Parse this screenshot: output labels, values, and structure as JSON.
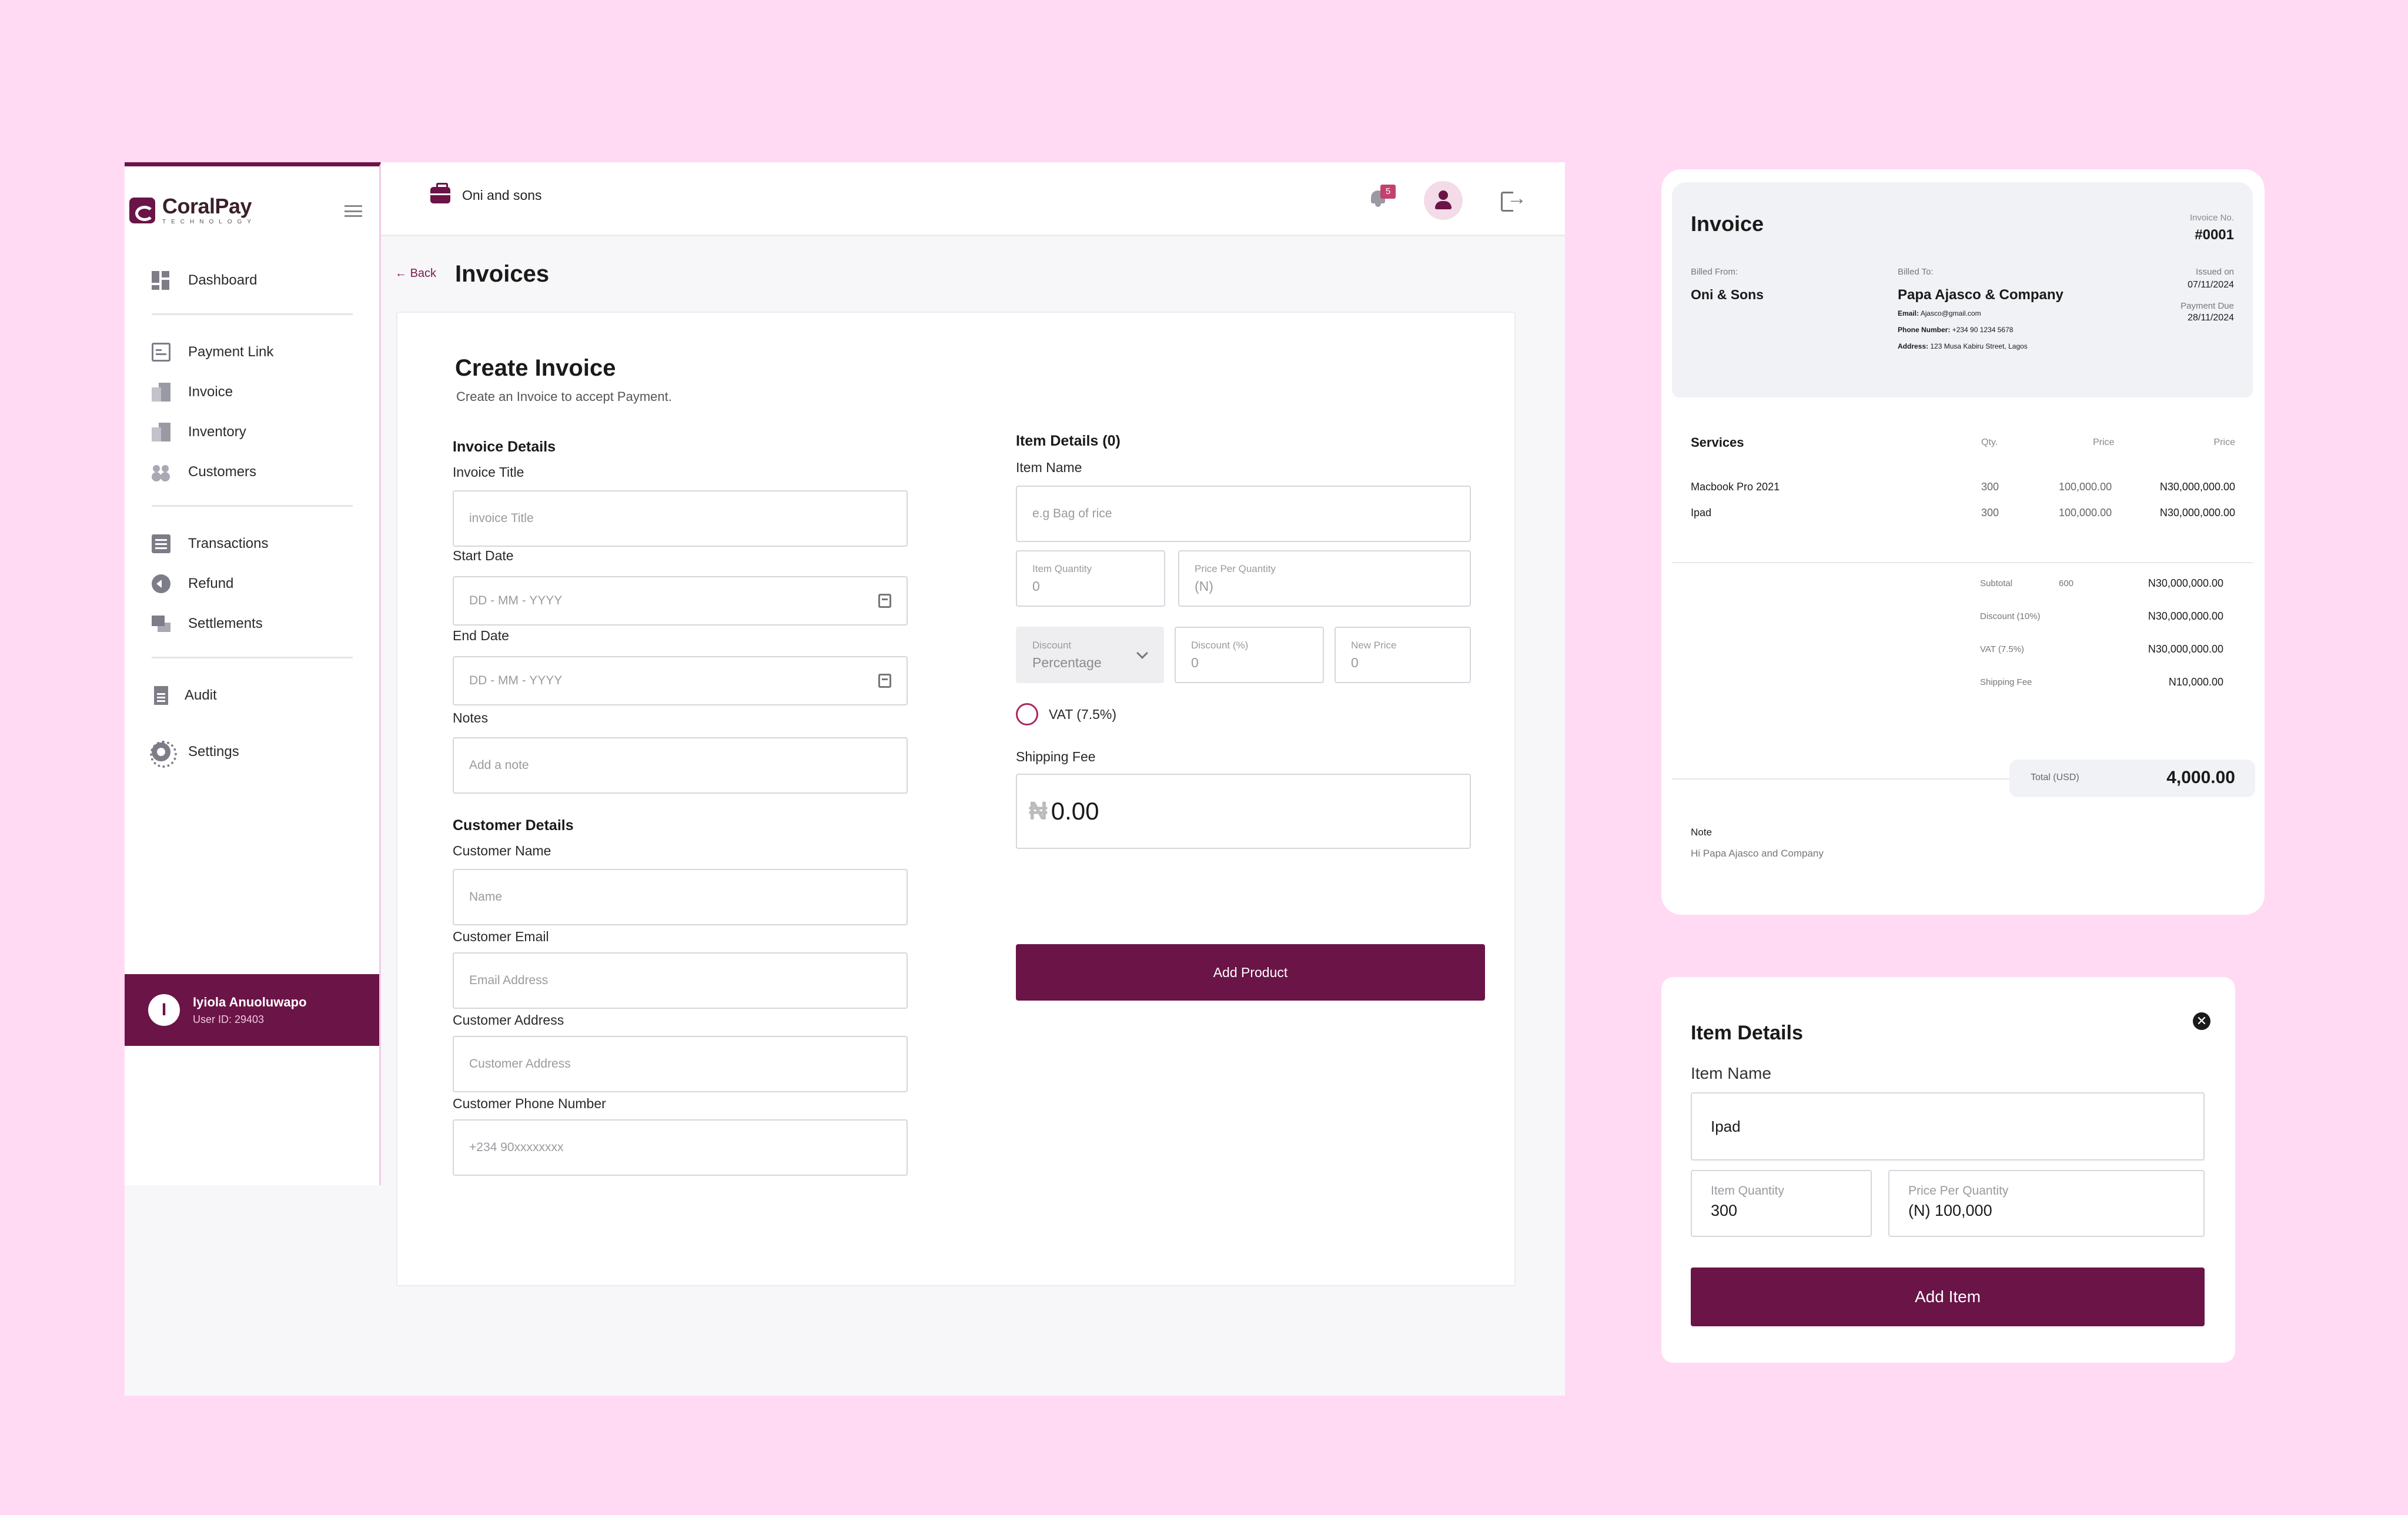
{
  "app": {
    "logo": {
      "name": "CoralPay",
      "sub": "TECHNOLOGY"
    },
    "sidebar": {
      "items": [
        {
          "label": "Dashboard",
          "icon": "dashboard-icon"
        },
        {
          "label": "Payment Link",
          "icon": "payment-link-icon"
        },
        {
          "label": "Invoice",
          "icon": "invoice-icon"
        },
        {
          "label": "Inventory",
          "icon": "inventory-icon"
        },
        {
          "label": "Customers",
          "icon": "customers-icon"
        },
        {
          "label": "Transactions",
          "icon": "transactions-icon"
        },
        {
          "label": "Refund",
          "icon": "refund-icon"
        },
        {
          "label": "Settlements",
          "icon": "settlements-icon"
        },
        {
          "label": "Audit",
          "icon": "audit-icon"
        },
        {
          "label": "Settings",
          "icon": "settings-icon"
        }
      ],
      "user": {
        "initial": "I",
        "name": "Iyiola Anuoluwapo",
        "id": "User ID: 29403"
      }
    },
    "topbar": {
      "org": "Oni and sons",
      "notifications": "5"
    },
    "back_label": "Back",
    "page_title": "Invoices",
    "form": {
      "title": "Create Invoice",
      "subtitle": "Create an Invoice to accept Payment.",
      "invoice_details": {
        "heading": "Invoice Details",
        "title_label": "Invoice Title",
        "title_placeholder": "invoice Title",
        "start_label": "Start Date",
        "start_placeholder": "DD - MM - YYYY",
        "end_label": "End Date",
        "end_placeholder": "DD - MM - YYYY",
        "notes_label": "Notes",
        "notes_placeholder": "Add a note"
      },
      "customer_details": {
        "heading": "Customer Details",
        "name_label": "Customer Name",
        "name_placeholder": "Name",
        "email_label": "Customer Email",
        "email_placeholder": "Email Address",
        "address_label": "Customer Address",
        "address_placeholder": "Customer Address",
        "phone_label": "Customer Phone Number",
        "phone_placeholder": "+234 90xxxxxxxx"
      },
      "item_details": {
        "heading": "Item Details (0)",
        "name_label": "Item Name",
        "name_placeholder": "e.g Bag of rice",
        "qty_label": "Item Quantity",
        "qty_value": "0",
        "ppq_label": "Price Per Quantity",
        "ppq_value": "(N)",
        "discount_label": "Discount",
        "discount_value": "Percentage",
        "discount_pct_label": "Discount (%)",
        "discount_pct_value": "0",
        "new_price_label": "New Price",
        "new_price_value": "0",
        "vat_label": "VAT (7.5%)",
        "shipping_label": "Shipping Fee",
        "shipping_currency": "₦",
        "shipping_value": "0.00",
        "add_product": "Add Product"
      }
    }
  },
  "invoice": {
    "title": "Invoice",
    "number_label": "Invoice No.",
    "number": "#0001",
    "billed_from_label": "Billed From:",
    "billed_from": "Oni & Sons",
    "billed_to_label": "Billed To:",
    "billed_to": "Papa Ajasco & Company",
    "email_label": "Email:",
    "email": "Ajasco@gmail.com",
    "phone_label": "Phone Number:",
    "phone": "+234 90 1234 5678",
    "address_label": "Address:",
    "address": "123 Musa Kabiru Street, Lagos",
    "issued_label": "Issued on",
    "issued": "07/11/2024",
    "due_label": "Payment Due",
    "due": "28/11/2024",
    "table_headers": [
      "Services",
      "Qty.",
      "Price",
      "Price"
    ],
    "rows": [
      {
        "service": "Macbook Pro 2021",
        "qty": "300",
        "price": "100,000.00",
        "total": "N30,000,000.00"
      },
      {
        "service": "Ipad",
        "qty": "300",
        "price": "100,000.00",
        "total": "N30,000,000.00"
      }
    ],
    "subtotal_label": "Subtotal",
    "subtotal_qty": "600",
    "subtotal": "N30,000,000.00",
    "discount_label": "Discount (10%)",
    "discount": "N30,000,000.00",
    "vat_label": "VAT (7.5%)",
    "vat": "N30,000,000.00",
    "shipping_label": "Shipping Fee",
    "shipping": "N10,000.00",
    "total_label": "Total (USD)",
    "total": "4,000.00",
    "note_label": "Note",
    "note": "Hi Papa Ajasco and Company"
  },
  "item_modal": {
    "title": "Item Details",
    "name_label": "Item Name",
    "name_value": "Ipad",
    "qty_label": "Item Quantity",
    "qty_value": "300",
    "ppq_label": "Price Per Quantity",
    "ppq_value": "(N) 100,000",
    "add_button": "Add Item",
    "close_glyph": "✕"
  },
  "colors": {
    "brand": "#6a1447",
    "background": "#ffdaf2",
    "accent": "#c2416f"
  }
}
